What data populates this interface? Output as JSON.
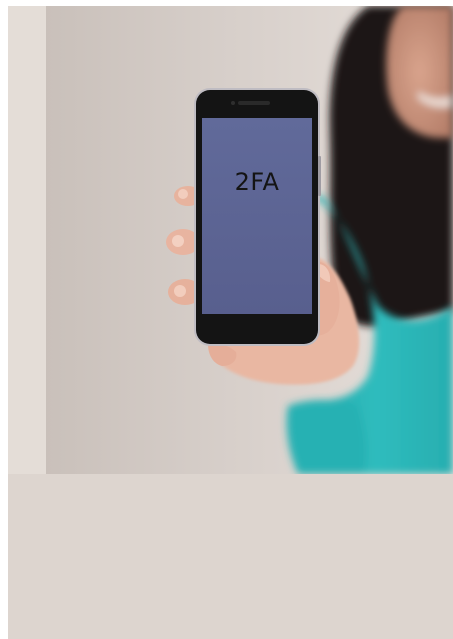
{
  "photo": {
    "alt": "",
    "phone_screen_text": "2FA"
  },
  "colors": {
    "background": "#ddd5cf",
    "wall": "#d6cec8",
    "shirt": "#2cb6b8",
    "hair": "#1e1715",
    "skin": "#e9b7a2",
    "phone_body": "#141414",
    "phone_screen": "#5d6596"
  }
}
